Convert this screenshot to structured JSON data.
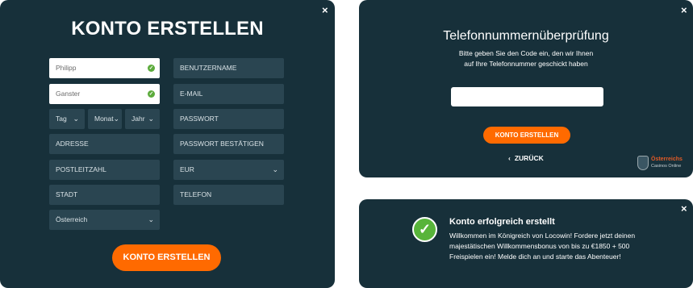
{
  "registration": {
    "title": "KONTO ERSTELLEN",
    "close": "×",
    "first_name": "Philipp",
    "last_name": "Ganster",
    "day": "Tag",
    "month": "Monat",
    "year": "Jahr",
    "address": "ADRESSE",
    "postal_code": "POSTLEITZAHL",
    "city": "STADT",
    "country": "Österreich",
    "username": "BENUTZERNAME",
    "email": "E-MAIL",
    "password": "PASSWORT",
    "password_confirm": "PASSWORT BESTÄTIGEN",
    "currency": "EUR",
    "phone": "TELEFON",
    "submit_label": "KONTO ERSTELLEN"
  },
  "verify": {
    "close": "×",
    "title": "Telefonnummernüberprüfung",
    "text_line1": "Bitte geben Sie den Code ein, den wir Ihnen",
    "text_line2": "auf Ihre Telefonnummer geschickt haben",
    "code_value": "",
    "submit_label": "KONTO ERSTELLEN",
    "back_label": "ZURÜCK",
    "logo_line1": "Österreichs",
    "logo_line2": "Casinos Online"
  },
  "success": {
    "close": "×",
    "title": "Konto erfolgreich erstellt",
    "message": "Willkommen im Königreich von Locowin! Fordere jetzt deinen majestätischen Willkommensbonus von bis zu €1850 + 500 Freispielen ein! Melde dich an und starte das Abenteuer!"
  },
  "icons": {
    "check": "check-icon",
    "chevron": "chevron-down-icon",
    "back": "chevron-left-icon",
    "close": "close-icon"
  },
  "colors": {
    "panel": "#17303a",
    "field": "#2a4551",
    "accent": "#ff6a00",
    "success": "#58b43a"
  }
}
